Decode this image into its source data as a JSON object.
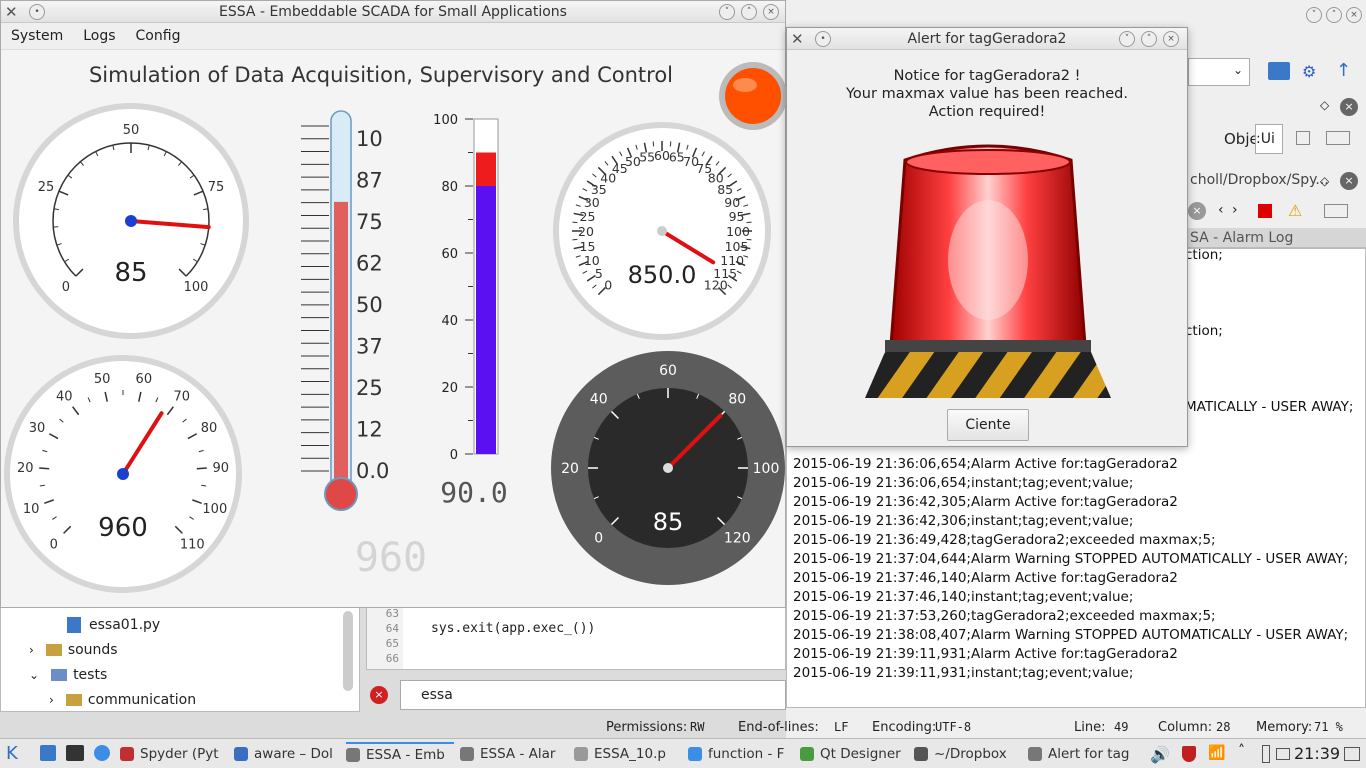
{
  "essa": {
    "title": "ESSA - Embeddable SCADA for Small Applications",
    "menu": [
      "System",
      "Logs",
      "Config"
    ],
    "heading": "Simulation of Data Acquisition, Supervisory and Control",
    "gauge1": {
      "value": "85",
      "ticks": [
        "0",
        "25",
        "50",
        "75",
        "100"
      ]
    },
    "gauge2": {
      "value": "960",
      "ticks": [
        "0",
        "10",
        "20",
        "30",
        "40",
        "50",
        "60",
        "70",
        "80",
        "90",
        "100",
        "110"
      ]
    },
    "thermo": {
      "labels": [
        "10",
        "87",
        "75",
        "62",
        "50",
        "37",
        "25",
        "12",
        "0.0"
      ],
      "level": 0.78,
      "lcd": "960"
    },
    "bar": {
      "labels": [
        "100",
        "80",
        "60",
        "40",
        "20",
        "0"
      ],
      "blue": 80,
      "red": 90,
      "lcd": "90.0"
    },
    "speed": {
      "value": "850.0",
      "ticks": [
        "0",
        "5",
        "10",
        "15",
        "20",
        "25",
        "30",
        "35",
        "40",
        "45",
        "50",
        "55",
        "60",
        "65",
        "70",
        "75",
        "80",
        "85",
        "90",
        "95",
        "100",
        "105",
        "110",
        "115",
        "120"
      ]
    },
    "dark": {
      "value": "85",
      "ticks": [
        "0",
        "20",
        "40",
        "60",
        "80",
        "100",
        "120"
      ]
    }
  },
  "alert": {
    "title": "Alert for tagGeradora2",
    "line1": "Notice for tagGeradora2 !",
    "line2": "Your maxmax value has been reached.",
    "line3": "Action required!",
    "button": "Ciente"
  },
  "spyder": {
    "object_label": "Object",
    "object_value": ":Ui",
    "path": "choll/Dropbox/Spy...",
    "alarm_tab": "SA - Alarm Log",
    "code_lines": [
      "63",
      "64",
      "65",
      "66"
    ],
    "code_text": "sys.exit(app.exec_())",
    "search": "essa",
    "tree": [
      "essa01.py",
      "sounds",
      "tests",
      "communication"
    ],
    "status": {
      "perm_l": "Permissions:",
      "perm_v": "RW",
      "eol_l": "End-of-lines:",
      "eol_v": "LF",
      "enc_l": "Encoding:",
      "enc_v": "UTF-8",
      "line_l": "Line:",
      "line_v": "49",
      "col_l": "Column:",
      "col_v": "28",
      "mem_l": "Memory:",
      "mem_v": "71 %"
    }
  },
  "log": {
    "partial": [
      "ction;",
      "ction;",
      "MATICALLY - USER AWAY;"
    ],
    "lines": [
      "2015-06-19 21:36:06,654;Alarm Active for:tagGeradora2",
      "2015-06-19 21:36:06,654;instant;tag;event;value;",
      "2015-06-19 21:36:42,305;Alarm Active for:tagGeradora2",
      "2015-06-19 21:36:42,306;instant;tag;event;value;",
      "2015-06-19 21:36:49,428;tagGeradora2;exceeded maxmax;5;",
      "2015-06-19 21:37:04,644;Alarm Warning STOPPED AUTOMATICALLY - USER AWAY;",
      "2015-06-19 21:37:46,140;Alarm Active for:tagGeradora2",
      "2015-06-19 21:37:46,140;instant;tag;event;value;",
      "2015-06-19 21:37:53,260;tagGeradora2;exceeded maxmax;5;",
      "2015-06-19 21:38:08,407;Alarm Warning STOPPED AUTOMATICALLY - USER AWAY;",
      "2015-06-19 21:39:11,931;Alarm Active for:tagGeradora2",
      "2015-06-19 21:39:11,931;instant;tag;event;value;"
    ]
  },
  "taskbar": {
    "items": [
      "Spyder (Pyt",
      "aware – Dol",
      "ESSA - Emb",
      "ESSA - Alar",
      "ESSA_10.p",
      "function - F",
      "Qt Designer",
      "~/Dropbox",
      "Alert for tag"
    ],
    "clock": "21:39"
  },
  "colors": {
    "alarm_red": "#e02020",
    "bar_blue": "#5a10f0",
    "lamp": "#ff5000",
    "accent": "#3a8ee6"
  }
}
